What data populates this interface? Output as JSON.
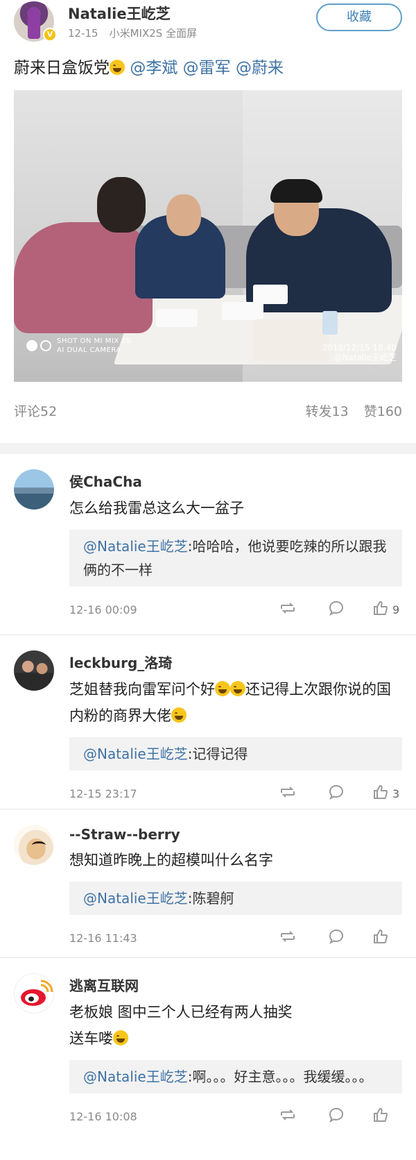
{
  "post": {
    "author": "Natalie王屹芝",
    "date": "12-15",
    "device": "小米MIX2S 全面屏",
    "favorite_label": "收藏",
    "text_prefix": "蔚来日盒饭党",
    "mentions": [
      "@李斌",
      "@雷军",
      "@蔚来"
    ],
    "photo": {
      "shot_line1": "SHOT ON MI MIX 2S",
      "shot_line2": "AI DUAL CAMERA",
      "stamp_line1": "2018/12/15 18:40",
      "stamp_line2": "@Natalie王屹芝"
    },
    "stats": {
      "comments": "评论52",
      "reposts": "转发13",
      "likes": "赞160"
    }
  },
  "comments": [
    {
      "user": "侯ChaCha",
      "text": "怎么给我雷总这么大一盆子",
      "reply_user": "@Natalie王屹芝",
      "reply_text": ":哈哈哈，他说要吃辣的所以跟我俩的不一样",
      "time": "12-16 00:09",
      "likes": "9"
    },
    {
      "user": "leckburg_洛琦",
      "text_part1": "芝姐替我向雷军问个好",
      "text_part2": "还记得上次跟你说的国内粉的商界大佬",
      "reply_user": "@Natalie王屹芝",
      "reply_text": ":记得记得",
      "time": "12-15 23:17",
      "likes": "3"
    },
    {
      "user": "--Straw--berry",
      "text": "想知道昨晚上的超模叫什么名字",
      "reply_user": "@Natalie王屹芝",
      "reply_text": ":陈碧舸",
      "time": "12-16 11:43",
      "likes": ""
    },
    {
      "user": "逃离互联网",
      "text": "老板娘 图中三个人已经有两人抽奖送车喽",
      "reply_user": "@Natalie王屹芝",
      "reply_text": ":啊。。。好主意。。。我缓缓。。。",
      "time": "12-16 10:08",
      "likes": ""
    }
  ]
}
